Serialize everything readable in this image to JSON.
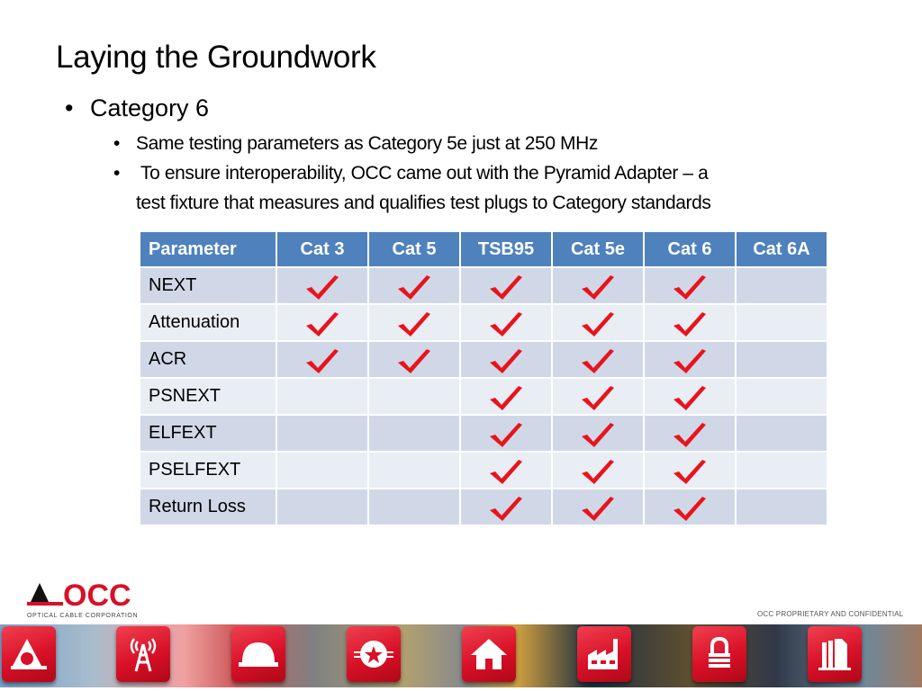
{
  "slide": {
    "title": "Laying the Groundwork",
    "bullet_level1": "Category 6",
    "bullets_level2": [
      "Same testing parameters as Category 5e just at 250 MHz",
      " To ensure interoperability, OCC came out with the Pyramid Adapter – a",
      "test fixture that measures  and qualifies test plugs to Category standards"
    ],
    "bullet_char": "•"
  },
  "table": {
    "headers": [
      "Parameter",
      "Cat 3",
      "Cat 5",
      "TSB95",
      "Cat 5e",
      "Cat 6",
      "Cat 6A"
    ],
    "rows": [
      {
        "parameter": "NEXT",
        "checks": [
          true,
          true,
          true,
          true,
          true,
          false
        ]
      },
      {
        "parameter": "Attenuation",
        "checks": [
          true,
          true,
          true,
          true,
          true,
          false
        ]
      },
      {
        "parameter": "ACR",
        "checks": [
          true,
          true,
          true,
          true,
          true,
          false
        ]
      },
      {
        "parameter": "PSNEXT",
        "checks": [
          false,
          false,
          true,
          true,
          true,
          false
        ]
      },
      {
        "parameter": "ELFEXT",
        "checks": [
          false,
          false,
          true,
          true,
          true,
          false
        ]
      },
      {
        "parameter": "PSELFEXT",
        "checks": [
          false,
          false,
          true,
          true,
          true,
          false
        ]
      },
      {
        "parameter": "Return Loss",
        "checks": [
          false,
          false,
          true,
          true,
          true,
          false
        ]
      }
    ],
    "check_icon": "red-checkmark",
    "colors": {
      "header": "#4f81bd",
      "row_odd": "#d0d8e8",
      "row_even": "#e9edf4",
      "check": "#e8141c"
    }
  },
  "footer": {
    "logo_text": "OCC",
    "logo_subtitle": "OPTICAL CABLE CORPORATION",
    "confidential": "OCC PROPRIETARY AND CONFIDENTIAL",
    "banner_icons": [
      "pyramid-logo-icon",
      "radio-tower-icon",
      "hard-hat-icon",
      "military-star-icon",
      "house-icon",
      "factory-icon",
      "padlock-icon",
      "office-building-icon"
    ],
    "brand_color": "#d81028"
  }
}
